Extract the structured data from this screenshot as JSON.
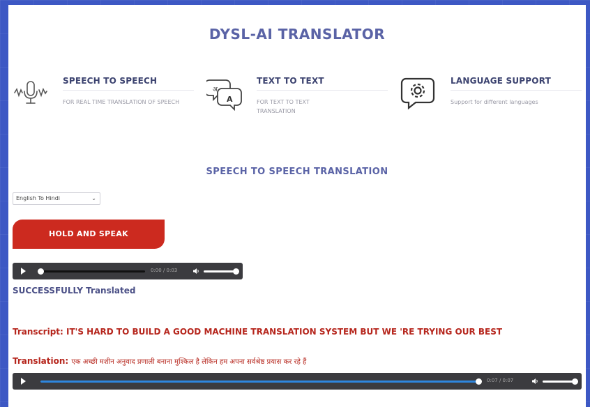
{
  "app": {
    "title": "DYSL-AI TRANSLATOR"
  },
  "features": [
    {
      "icon": "microphone-wave-icon",
      "title": "SPEECH TO SPEECH",
      "desc": "FOR REAL TIME TRANSLATION OF SPEECH"
    },
    {
      "icon": "translate-bubbles-icon",
      "title": "TEXT TO TEXT",
      "desc": "FOR TEXT TO TEXT TRANSLATION"
    },
    {
      "icon": "settings-chat-icon",
      "title": "LANGUAGE SUPPORT",
      "desc": "Support for different languages"
    }
  ],
  "section": {
    "title": "SPEECH TO SPEECH TRANSLATION"
  },
  "language_select": {
    "selected": "English To Hindi"
  },
  "hold_button": {
    "label": "HOLD AND SPEAK"
  },
  "player1": {
    "time": "0:00 / 0:03",
    "progress": 0.0,
    "volume": 1.0
  },
  "status": {
    "text": "SUCCESSFULLY Translated"
  },
  "transcript": {
    "label": "Transcript:",
    "value": "IT'S HARD TO BUILD A GOOD MACHINE TRANSLATION SYSTEM BUT WE 'RE TRYING OUR BEST"
  },
  "translation": {
    "label": "Translation:",
    "value": "एक अच्छी मशीन अनुवाद प्रणाली बनाना मुश्किल है लेकिन हम अपना सर्वश्रेष्ठ प्रयास कर रहे हैं"
  },
  "player2": {
    "time": "0:07 / 0:07",
    "progress": 1.0,
    "volume": 1.0
  },
  "colors": {
    "accent": "#5a63a6",
    "button": "#cc2a1f",
    "alert_text": "#b6261d",
    "frame": "#3d58c4"
  }
}
